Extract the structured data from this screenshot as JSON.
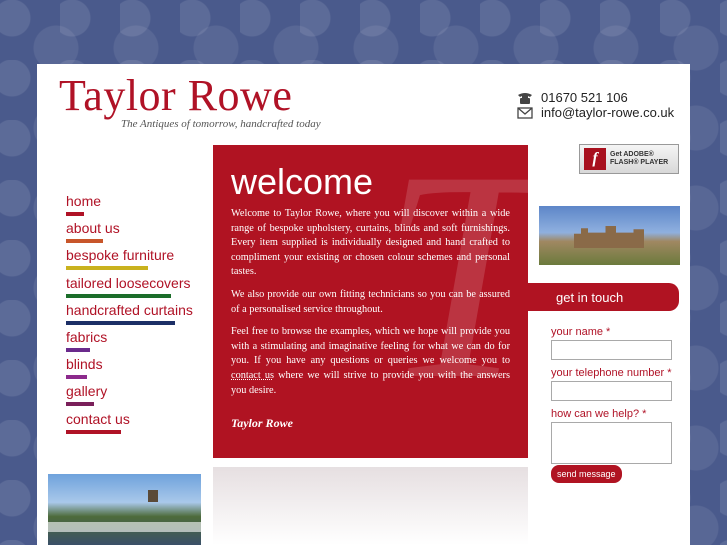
{
  "brand": {
    "title": "Taylor Rowe",
    "tagline": "The Antiques of tomorrow, handcrafted today"
  },
  "contact": {
    "phone": "01670 521 106",
    "email": "info@taylor-rowe.co.uk",
    "phone_icon": "phone-icon",
    "email_icon": "envelope-icon"
  },
  "flash": {
    "line1": "Get ADOBE®",
    "line2": "FLASH® PLAYER"
  },
  "nav": {
    "items": [
      {
        "label": "home",
        "color": "#b01226"
      },
      {
        "label": "about us",
        "color": "#c8562a"
      },
      {
        "label": "bespoke furniture",
        "color": "#c9b21e"
      },
      {
        "label": "tailored loosecovers",
        "color": "#1b6d2a"
      },
      {
        "label": "handcrafted curtains",
        "color": "#1c2f66"
      },
      {
        "label": "fabrics",
        "color": "#6a2a8c"
      },
      {
        "label": "blinds",
        "color": "#8c2a8c"
      },
      {
        "label": "gallery",
        "color": "#7a1f5a"
      },
      {
        "label": "contact us",
        "color": "#b01226"
      }
    ]
  },
  "welcome": {
    "heading": "welcome",
    "paragraphs": [
      "Welcome to Taylor Rowe, where you will discover within a wide range of bespoke upholstery, curtains, blinds and soft furnishings. Every item supplied is individually designed and hand crafted to compliment your existing or chosen colour schemes and personal tastes.",
      "We also provide our own fitting technicians so you can be assured of a personalised service throughout."
    ],
    "para3_before": "Feel free to browse the examples, which we hope will provide you with a stimulating and imaginative feeling for what we can do for you. If you have any questions or queries we welcome you to ",
    "para3_link": "contact us",
    "para3_after": " where we will strive to provide you with the answers you desire.",
    "signature": "Taylor Rowe"
  },
  "get_in_touch": {
    "title": "get in touch",
    "name_label": "your name *",
    "phone_label": "your telephone number *",
    "help_label": "how can we help? *",
    "submit": "send message"
  },
  "colors": {
    "brand_red": "#b01322",
    "background": "#4a5a8c"
  }
}
